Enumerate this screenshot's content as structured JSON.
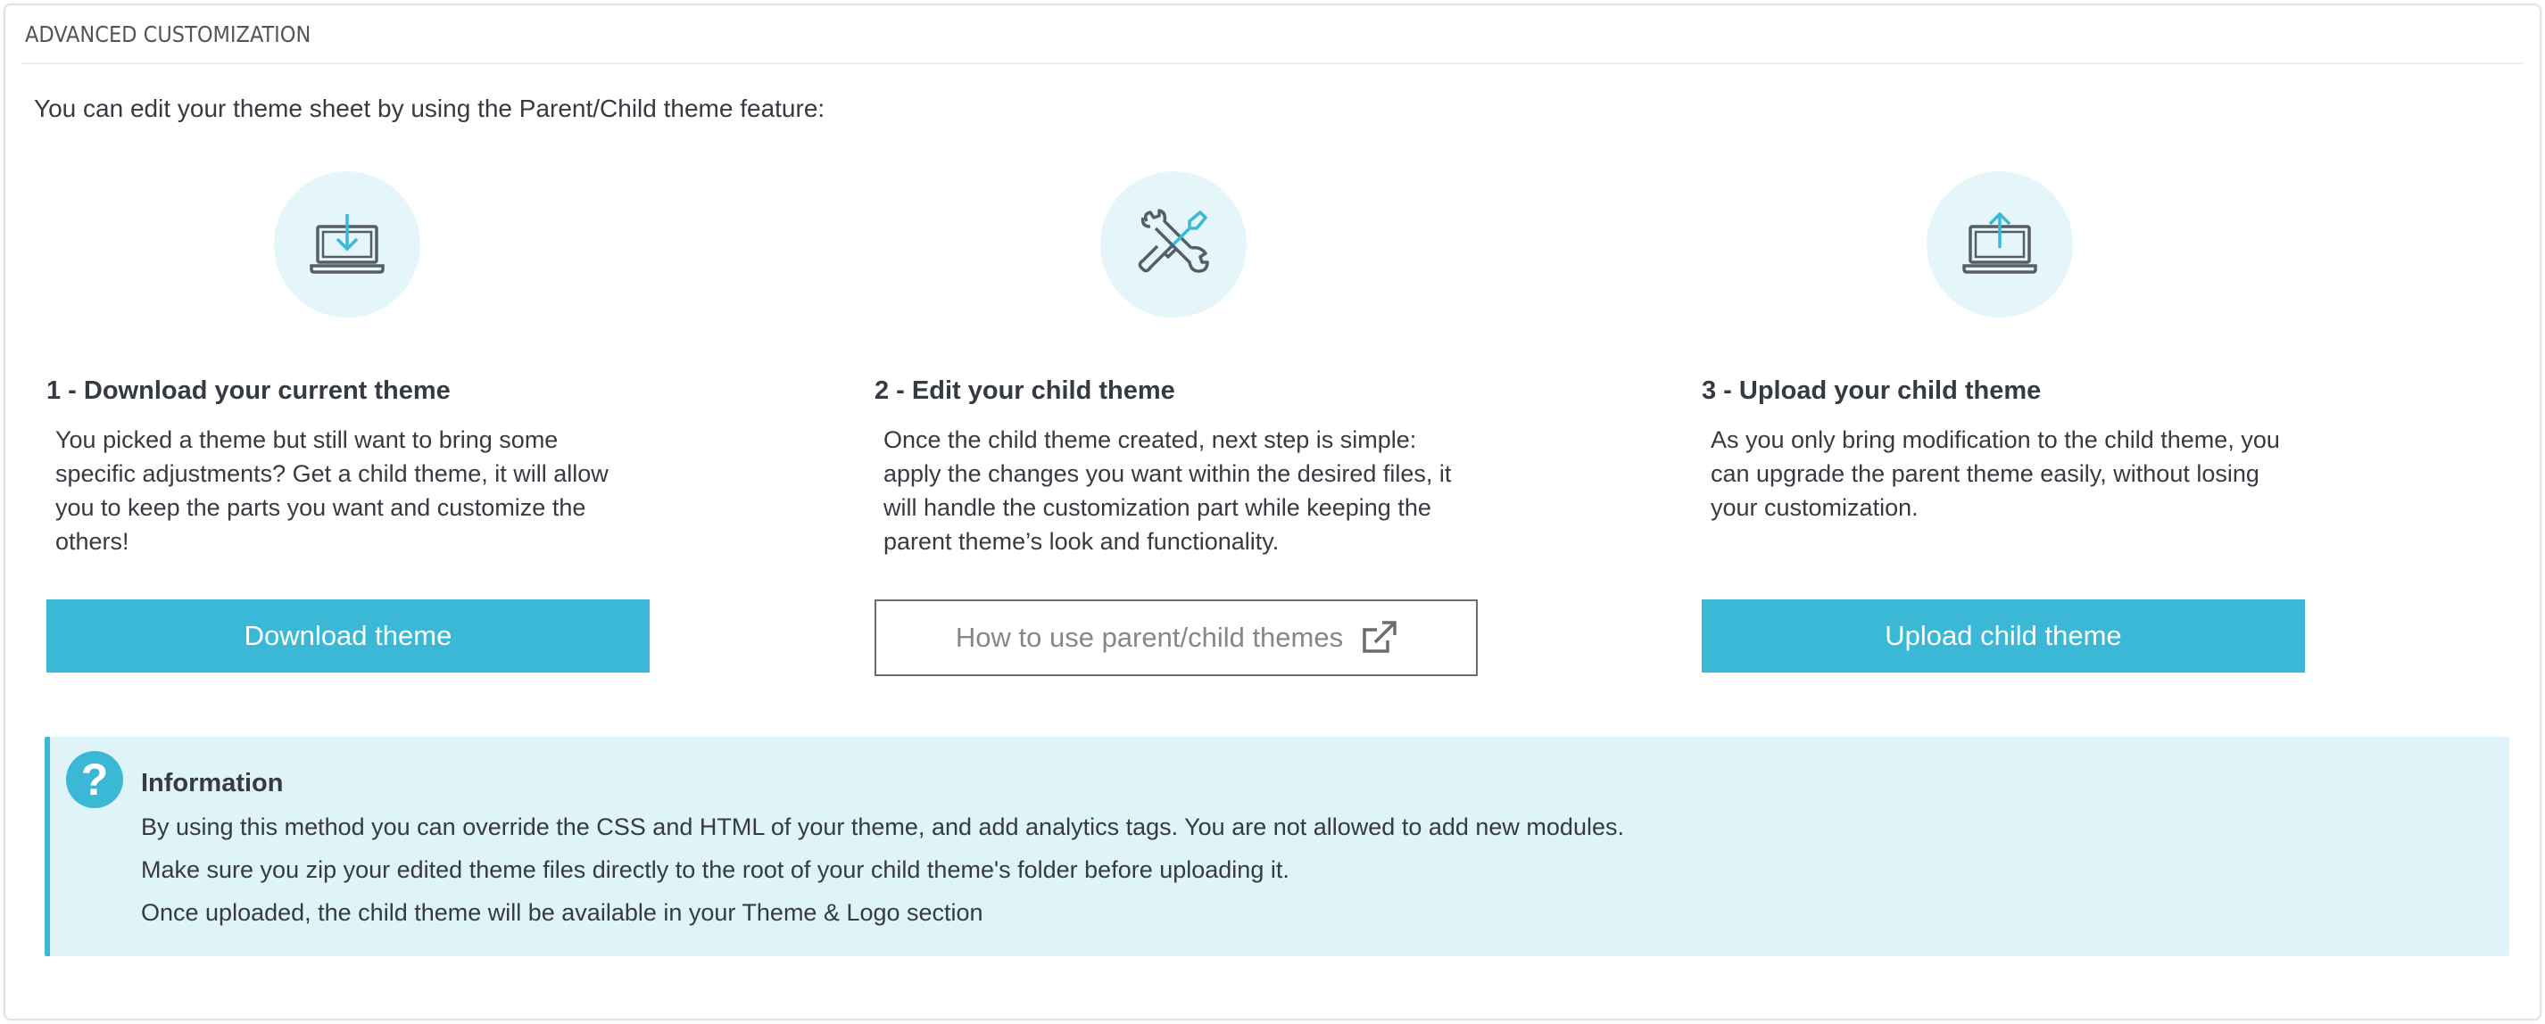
{
  "panel": {
    "title": "ADVANCED CUSTOMIZATION",
    "intro": "You can edit your theme sheet by using the Parent/Child theme feature:"
  },
  "steps": [
    {
      "icon": "laptop-download-icon",
      "title": "1 - Download your current theme",
      "description": "You picked a theme but still want to bring some specific adjustments? Get a child theme, it will allow you to keep the parts you want and customize the others!",
      "button_label": "Download theme"
    },
    {
      "icon": "tools-icon",
      "title": "2 - Edit your child theme",
      "description": "Once the child theme created, next step is simple: apply the changes you want within the desired files, it will handle the customization part while keeping the parent theme’s look and functionality.",
      "button_label": "How to use parent/child themes"
    },
    {
      "icon": "laptop-upload-icon",
      "title": "3 - Upload your child theme",
      "description": "As you only bring modification to the child theme, you can upgrade the parent theme easily, without losing your customization.",
      "button_label": "Upload child theme"
    }
  ],
  "info": {
    "icon_glyph": "?",
    "title": "Information",
    "lines": [
      "By using this method you can override the CSS and HTML of your theme, and add analytics tags. You are not allowed to add new modules.",
      "Make sure you zip your edited theme files directly to the root of your child theme's folder before uploading it.",
      "Once uploaded, the child theme will be available in your Theme & Logo section"
    ]
  },
  "colors": {
    "accent": "#3ab8d6",
    "icon_circle_bg": "#e5f6fa",
    "info_bg": "#dff4f9",
    "icon_dark": "#565d66"
  }
}
